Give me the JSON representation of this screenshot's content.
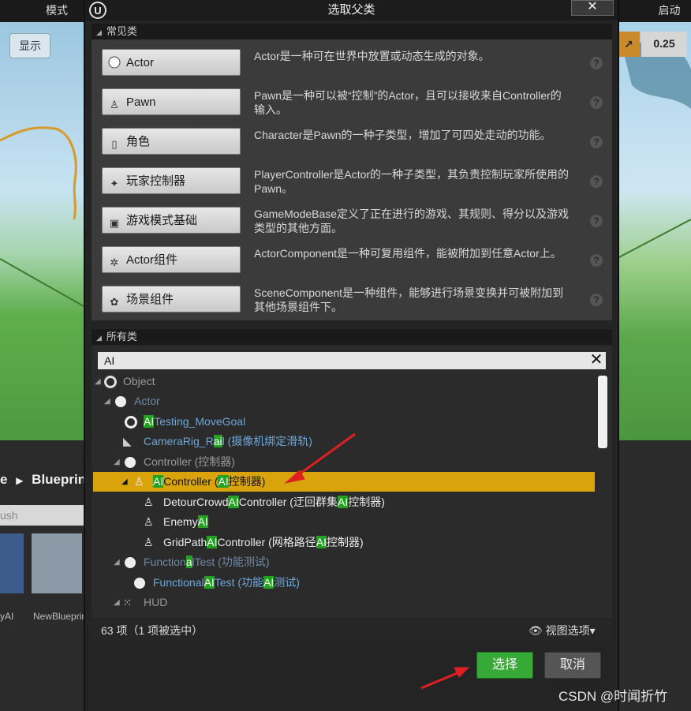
{
  "background": {
    "left_tab": "模式",
    "right_tab": "启动",
    "show_button": "显示",
    "snap_value": "0.25",
    "breadcrumb_last": "Blueprints",
    "breadcrumb_prefix": "e",
    "search_placeholder": "ush",
    "asset_left_label": "yAI",
    "asset_right_label": "NewBlueprint"
  },
  "dialog": {
    "title": "选取父类",
    "close_label": "✕",
    "common_header": "常见类",
    "all_header": "所有类",
    "common_classes": [
      {
        "label": "Actor",
        "icon": "sphere-icon",
        "desc": "Actor是一种可在世界中放置或动态生成的对象。"
      },
      {
        "label": "Pawn",
        "icon": "pawn-icon",
        "desc": "Pawn是一种可以被“控制”的Actor，且可以接收来自Controller的输入。"
      },
      {
        "label": "角色",
        "icon": "character-icon",
        "desc": "Character是Pawn的一种子类型，增加了可四处走动的功能。"
      },
      {
        "label": "玩家控制器",
        "icon": "controller-icon",
        "desc": "PlayerController是Actor的一种子类型，其负责控制玩家所使用的Pawn。"
      },
      {
        "label": "游戏模式基础",
        "icon": "gamemode-icon",
        "desc": "GameModeBase定义了正在进行的游戏、其规则、得分以及游戏类型的其他方面。"
      },
      {
        "label": "Actor组件",
        "icon": "component-icon",
        "desc": "ActorComponent是一种可复用组件，能被附加到任意Actor上。"
      },
      {
        "label": "场景组件",
        "icon": "scene-component-icon",
        "desc": "SceneComponent是一种组件，能够进行场景变换并可被附加到其他场景组件下。"
      }
    ],
    "help_glyph": "?",
    "filter_text": "AI",
    "filter_clear": "✕",
    "tree": {
      "object": "Object",
      "actor": "Actor",
      "ai_testing_pre": "",
      "ai_testing_hl": "AI",
      "ai_testing_post": "Testing_MoveGoal",
      "camerarig_pre": "CameraRig_R",
      "camerarig_hl": "ai",
      "camerarig_post": "l (摄像机绑定滑轨)",
      "controller": "Controller (控制器)",
      "aicontroller_hl1": "AI",
      "aicontroller_mid": "Controller (",
      "aicontroller_hl2": "AI",
      "aicontroller_post": "控制器)",
      "detour_pre": "DetourCrowd",
      "detour_hl1": "AI",
      "detour_mid": "Controller (迂回群集",
      "detour_hl2": "AI",
      "detour_post": "控制器)",
      "enemy_pre": "Enemy",
      "enemy_hl": "AI",
      "gridpath_pre": "GridPath",
      "gridpath_hl1": "AI",
      "gridpath_mid": "Controller (网格路径",
      "gridpath_hl2": "AI",
      "gridpath_post": "控制器)",
      "functional_pre": "Function",
      "functional_hl": "a",
      "functional_post": "lTest (功能测试)",
      "functionalai_pre": "Functional",
      "functionalai_hl1": "AI",
      "functionalai_mid": "Test (功能",
      "functionalai_hl2": "AI",
      "functionalai_post": "测试)",
      "hud": "HUD"
    },
    "status_count": "63 项（1 项被选中）",
    "view_options": "视图选项",
    "select_button": "选择",
    "cancel_button": "取消"
  },
  "watermark": "CSDN @时闻折竹",
  "colors": {
    "highlight": "#24a121",
    "selected_row": "#d9a40b",
    "select_button": "#36a936",
    "arrow": "#e02020"
  }
}
